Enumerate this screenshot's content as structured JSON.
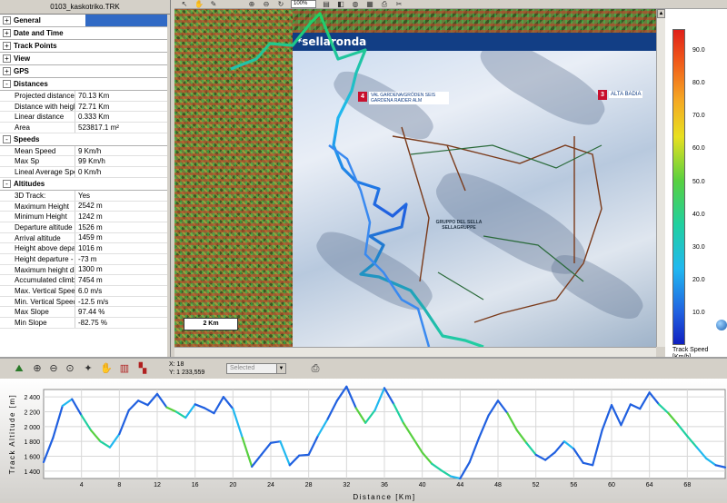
{
  "panel": {
    "title": "0103_kaskotriko.TRK",
    "sections": [
      {
        "label": "General",
        "sign": "+"
      },
      {
        "label": "Date and Time",
        "sign": "+"
      },
      {
        "label": "Track Points",
        "sign": "+"
      },
      {
        "label": "View",
        "sign": "+"
      },
      {
        "label": "GPS",
        "sign": "+"
      },
      {
        "label": "Distances",
        "sign": "-"
      },
      {
        "label": "Speeds",
        "sign": "-"
      },
      {
        "label": "Altitudes",
        "sign": "-"
      }
    ],
    "distances": [
      {
        "k": "Projected distance",
        "v": "70.13 Km"
      },
      {
        "k": "Distance with height",
        "v": "72.71 Km"
      },
      {
        "k": "Linear distance",
        "v": "0.333 Km"
      },
      {
        "k": "Area",
        "v": "523817.1 m²"
      }
    ],
    "speeds": [
      {
        "k": "Mean Speed",
        "v": "9 Km/h"
      },
      {
        "k": "Max Sp",
        "v": "99 Km/h"
      },
      {
        "k": "Lineal Average Speed",
        "v": "0 Km/h"
      }
    ],
    "altitudes": [
      {
        "k": "3D Track:",
        "v": "Yes"
      },
      {
        "k": "Maximum Height",
        "v": "2542 m"
      },
      {
        "k": "Minimum Height",
        "v": "1242 m"
      },
      {
        "k": "Departure altitude",
        "v": "1526 m"
      },
      {
        "k": "Arrival altitude",
        "v": "1459 m"
      },
      {
        "k": "Height above departure",
        "v": "1016 m"
      },
      {
        "k": "Height departure - arrival",
        "v": "-73 m"
      },
      {
        "k": "Maximum height difference",
        "v": "1300 m"
      },
      {
        "k": "Accumulated climb",
        "v": "7454 m"
      },
      {
        "k": "Max. Vertical Speed",
        "v": "6.0 m/s"
      },
      {
        "k": "Min. Vertical Speed",
        "v": "-12.5 m/s"
      },
      {
        "k": "Max Slope",
        "v": "97.44 %"
      },
      {
        "k": "Min Slope",
        "v": "-82.75 %"
      }
    ]
  },
  "toolbar": {
    "zoom_value": "100%"
  },
  "map": {
    "header": "*sellaronda",
    "badges": [
      {
        "num": "4",
        "text": "VAL GARDENA/GRÖDEN SEIS",
        "sub": "GARDENA RAIDER ALM"
      },
      {
        "num": "3",
        "text": "ALTA BADIA"
      }
    ],
    "massif_label": "GRUPPO DEL SELLA SELLAGRUPPE",
    "scale_label": "2 Km"
  },
  "legend": {
    "ticks": [
      "90.0",
      "80.0",
      "70.0",
      "60.0",
      "50.0",
      "40.0",
      "30.0",
      "20.0",
      "10.0"
    ],
    "title": "Track Speed",
    "unit": "[Km/h]",
    "colors": [
      "#e0201a",
      "#f5a623",
      "#e8e020",
      "#58d040",
      "#20d0a0",
      "#20b8f0",
      "#2060e0",
      "#1020c0"
    ]
  },
  "profile_toolbar": {
    "x_readout": "X: 18",
    "y_readout": "Y: 1 233,559",
    "select_value": "Selected"
  },
  "chart_data": {
    "type": "line",
    "xlabel": "Distance [Km]",
    "ylabel": "Track Altitude [m]",
    "xlim": [
      0,
      72
    ],
    "ylim": [
      1300,
      2500
    ],
    "yticks": [
      1400,
      1600,
      1800,
      2000,
      2200,
      2400
    ],
    "xticks": [
      4,
      8,
      12,
      16,
      20,
      24,
      28,
      32,
      36,
      40,
      44,
      48,
      52,
      56,
      60,
      64,
      68
    ],
    "series": [
      {
        "x": [
          0,
          1,
          2,
          3,
          4,
          5,
          6,
          7,
          8,
          9,
          10,
          11,
          12,
          13,
          14,
          15,
          16,
          17,
          18,
          19,
          20,
          21,
          22,
          23,
          24,
          25,
          26,
          27,
          28,
          29,
          30,
          31,
          32,
          33,
          34,
          35,
          36,
          37,
          38,
          39,
          40,
          41,
          42,
          43,
          44,
          45,
          46,
          47,
          48,
          49,
          50,
          51,
          52,
          53,
          54,
          55,
          56,
          57,
          58,
          59,
          60,
          61,
          62,
          63,
          64,
          65,
          66,
          67,
          68,
          69,
          70,
          71,
          72
        ],
        "y": [
          1520,
          1850,
          2280,
          2370,
          2150,
          1950,
          1800,
          1720,
          1900,
          2220,
          2350,
          2290,
          2440,
          2260,
          2200,
          2120,
          2300,
          2250,
          2180,
          2400,
          2240,
          1850,
          1460,
          1620,
          1780,
          1800,
          1480,
          1610,
          1620,
          1880,
          2100,
          2350,
          2540,
          2250,
          2050,
          2220,
          2520,
          2300,
          2050,
          1850,
          1650,
          1500,
          1410,
          1330,
          1300,
          1520,
          1850,
          2150,
          2350,
          2180,
          1950,
          1780,
          1620,
          1550,
          1650,
          1800,
          1700,
          1510,
          1480,
          1950,
          2290,
          2020,
          2300,
          2240,
          2460,
          2300,
          2180,
          2030,
          1870,
          1720,
          1570,
          1480,
          1450
        ],
        "speed": [
          9,
          20,
          30,
          10,
          45,
          55,
          40,
          25,
          15,
          10,
          12,
          10,
          8,
          60,
          45,
          30,
          12,
          8,
          10,
          8,
          30,
          50,
          20,
          10,
          12,
          30,
          10,
          15,
          20,
          25,
          18,
          15,
          10,
          60,
          45,
          30,
          10,
          40,
          55,
          60,
          50,
          45,
          40,
          30,
          20,
          10,
          15,
          20,
          12,
          55,
          50,
          40,
          20,
          15,
          10,
          30,
          20,
          10,
          12,
          20,
          15,
          10,
          20,
          12,
          10,
          45,
          50,
          45,
          40,
          35,
          30,
          20,
          10
        ]
      }
    ]
  }
}
